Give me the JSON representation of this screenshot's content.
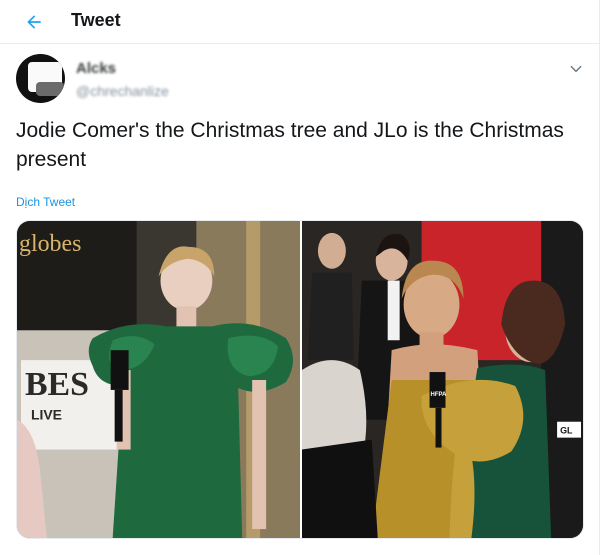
{
  "header": {
    "title": "Tweet",
    "back_icon": "arrow-left-icon",
    "accent": "#1da1f2"
  },
  "tweet": {
    "author": {
      "display_name": "Alcks",
      "handle": "@chrechanlize"
    },
    "text": "Jodie Comer's the Christmas tree and JLo is the Christmas present",
    "translate_label": "Dịch Tweet",
    "menu_icon": "chevron-down-icon"
  },
  "media": {
    "left_photo": {
      "sign_text": "globes",
      "backdrop_text": "BES",
      "backdrop_text2": "LIVE"
    },
    "right_photo": {
      "mic_text": "HFPA",
      "badge_text": "GL"
    }
  },
  "colors": {
    "link": "#1b95e0",
    "border": "#e6ecf0",
    "text": "#14171a",
    "secondary": "#657786"
  }
}
